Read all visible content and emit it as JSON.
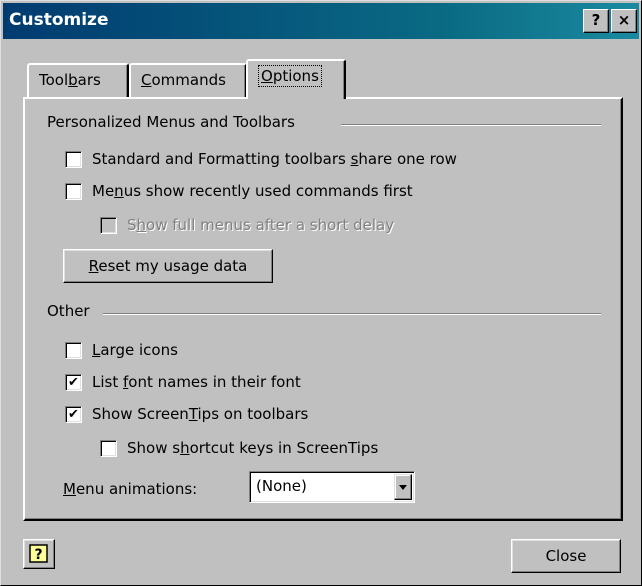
{
  "window": {
    "title": "Customize",
    "help_button": "?",
    "close_button": "×"
  },
  "tabs": [
    {
      "label": "Toolbars",
      "mnemonic_index": 4,
      "active": false
    },
    {
      "label": "Commands",
      "mnemonic_index": 0,
      "active": false
    },
    {
      "label": "Options",
      "mnemonic_index": 0,
      "active": true
    }
  ],
  "sections": {
    "personalized": {
      "title": "Personalized Menus and Toolbars",
      "options": [
        {
          "label": "Standard and Formatting toolbars share one row",
          "mnemonic_index": 40,
          "checked": false,
          "disabled": false
        },
        {
          "label": "Menus show recently used commands first",
          "mnemonic_index": 2,
          "checked": false,
          "disabled": false
        },
        {
          "label": "Show full menus after a short delay",
          "mnemonic_index": 1,
          "checked": false,
          "disabled": true
        }
      ],
      "reset_button": "Reset my usage data"
    },
    "other": {
      "title": "Other",
      "options": [
        {
          "label": "Large icons",
          "mnemonic_index": 0,
          "checked": true,
          "disabled": false
        },
        {
          "label": "List font names in their font",
          "mnemonic_index": 5,
          "checked": true,
          "disabled": false
        },
        {
          "label": "Show ScreenTips on toolbars",
          "mnemonic_index": 11,
          "checked": true,
          "disabled": false
        },
        {
          "label": "Show shortcut keys in ScreenTips",
          "mnemonic_index": 7,
          "checked": false,
          "disabled": false
        }
      ],
      "menu_animations_label": "Menu animations:",
      "menu_animations_value": "(None)"
    }
  },
  "footer": {
    "help_icon": "?",
    "close_label": "Close"
  },
  "colors": {
    "face": "#c0c0c0",
    "titlebar_start": "#003b70",
    "titlebar_end": "#1a8aa0",
    "disabled_text": "#808080"
  }
}
